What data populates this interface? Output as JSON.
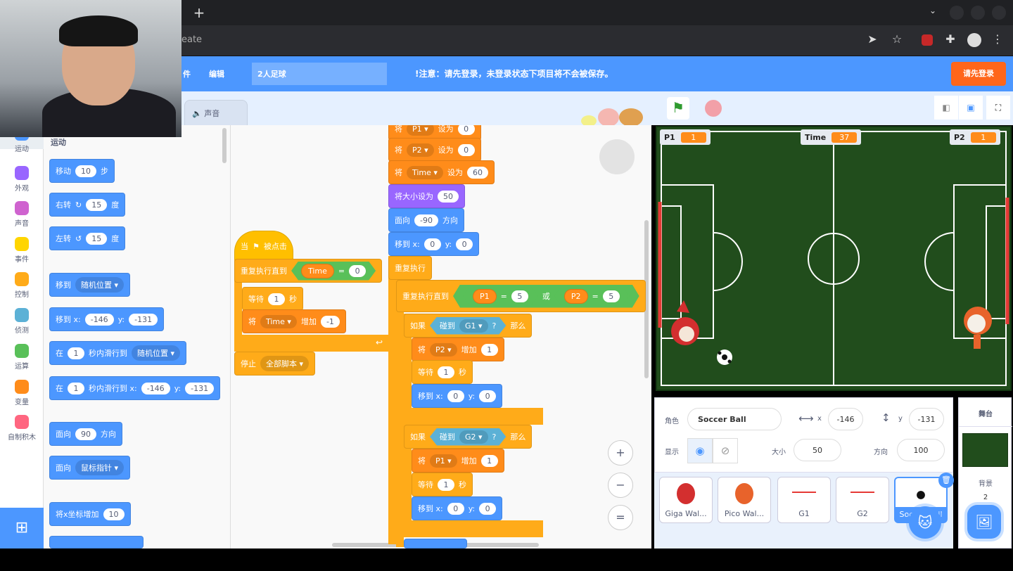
{
  "browser": {
    "new_tab": "+",
    "address_text": "eate",
    "colors": {
      "chrome": "#202124"
    }
  },
  "menu": {
    "file_partial": "件",
    "edit": "编辑",
    "project_title": "2人足球",
    "notice": "!注意：请先登录，未登录状态下项目将不会被保存。",
    "login_button": "请先登录"
  },
  "tabs": {
    "sound": "声音"
  },
  "categories": [
    {
      "label": "运动",
      "color": "#4c97ff"
    },
    {
      "label": "外观",
      "color": "#9966ff"
    },
    {
      "label": "声音",
      "color": "#cf63cf"
    },
    {
      "label": "事件",
      "color": "#ffd500"
    },
    {
      "label": "控制",
      "color": "#ffab19"
    },
    {
      "label": "侦测",
      "color": "#5cb1d6"
    },
    {
      "label": "运算",
      "color": "#59c059"
    },
    {
      "label": "变量",
      "color": "#ff8c1a"
    },
    {
      "label": "自制积木",
      "color": "#ff6680"
    }
  ],
  "palette": {
    "heading": "运动",
    "blocks": [
      {
        "cat": "motion",
        "parts": [
          {
            "text": "移动"
          },
          {
            "input": "10"
          },
          {
            "text": "步"
          }
        ]
      },
      {
        "cat": "motion",
        "parts": [
          {
            "text": "右转"
          },
          {
            "icon": "rotate-right-icon",
            "glyph": "↻"
          },
          {
            "input": "15"
          },
          {
            "text": "度"
          }
        ]
      },
      {
        "cat": "motion",
        "parts": [
          {
            "text": "左转"
          },
          {
            "icon": "rotate-left-icon",
            "glyph": "↺"
          },
          {
            "input": "15"
          },
          {
            "text": "度"
          }
        ]
      },
      {
        "cat": "motion",
        "parts": [
          {
            "text": "移到"
          },
          {
            "dropdown": "随机位置 ▾"
          }
        ]
      },
      {
        "cat": "motion",
        "parts": [
          {
            "text": "移到 x:"
          },
          {
            "input": "-146"
          },
          {
            "text": "y:"
          },
          {
            "input": "-131"
          }
        ]
      },
      {
        "cat": "motion",
        "parts": [
          {
            "text": "在"
          },
          {
            "input": "1"
          },
          {
            "text": "秒内滑行到"
          },
          {
            "dropdown": "随机位置 ▾"
          }
        ]
      },
      {
        "cat": "motion",
        "parts": [
          {
            "text": "在"
          },
          {
            "input": "1"
          },
          {
            "text": "秒内滑行到 x:"
          },
          {
            "input": "-146"
          },
          {
            "text": "y:"
          },
          {
            "input": "-131"
          }
        ]
      },
      {
        "cat": "motion",
        "parts": [
          {
            "text": "面向"
          },
          {
            "input": "90"
          },
          {
            "text": "方向"
          }
        ]
      },
      {
        "cat": "motion",
        "parts": [
          {
            "text": "面向"
          },
          {
            "dropdown": "鼠标指针 ▾"
          }
        ]
      },
      {
        "cat": "motion",
        "parts": [
          {
            "text": "将x坐标增加"
          },
          {
            "input": "10"
          }
        ]
      }
    ]
  },
  "scripts": [
    {
      "cat": "variables",
      "parts": [
        {
          "text": "将"
        },
        {
          "dropdown": "P1 ▾"
        },
        {
          "text": "设为"
        },
        {
          "input": "0"
        }
      ]
    },
    {
      "cat": "variables",
      "parts": [
        {
          "text": "将"
        },
        {
          "dropdown": "P2 ▾"
        },
        {
          "text": "设为"
        },
        {
          "input": "0"
        }
      ]
    },
    {
      "cat": "variables",
      "parts": [
        {
          "text": "将"
        },
        {
          "dropdown": "Time ▾"
        },
        {
          "text": "设为"
        },
        {
          "input": "60"
        }
      ]
    },
    {
      "cat": "looks",
      "parts": [
        {
          "text": "将大小设为"
        },
        {
          "input": "50"
        }
      ]
    },
    {
      "cat": "motion",
      "parts": [
        {
          "text": "面向"
        },
        {
          "input": "-90"
        },
        {
          "text": "方向"
        }
      ]
    },
    {
      "cat": "motion",
      "parts": [
        {
          "text": "移到 x:"
        },
        {
          "input": "0"
        },
        {
          "text": "y:"
        },
        {
          "input": "0"
        }
      ]
    },
    {
      "cat": "control",
      "parts": [
        {
          "text": "重复执行"
        }
      ]
    },
    {
      "cat": "control",
      "parts": [
        {
          "text": "重复执行直到"
        },
        {
          "bool": "operators",
          "parts": [
            {
              "bool": "operators",
              "parts": [
                {
                  "reporter": "P1",
                  "cat": "variables"
                },
                {
                  "text": "="
                },
                {
                  "input": "5"
                }
              ]
            },
            {
              "text": "或"
            },
            {
              "bool": "operators",
              "parts": [
                {
                  "reporter": "P2",
                  "cat": "variables"
                },
                {
                  "text": "="
                },
                {
                  "input": "5"
                }
              ]
            }
          ]
        }
      ]
    },
    {
      "cat": "control",
      "parts": [
        {
          "text": "如果"
        },
        {
          "bool": "sensing",
          "parts": [
            {
              "text": "碰到"
            },
            {
              "dropdown": "G1 ▾"
            },
            {
              "text": "?"
            }
          ]
        },
        {
          "text": "那么"
        }
      ]
    },
    {
      "cat": "variables",
      "parts": [
        {
          "text": "将"
        },
        {
          "dropdown": "P2 ▾"
        },
        {
          "text": "增加"
        },
        {
          "input": "1"
        }
      ]
    },
    {
      "cat": "control",
      "parts": [
        {
          "text": "等待"
        },
        {
          "input": "1"
        },
        {
          "text": "秒"
        }
      ]
    },
    {
      "cat": "motion",
      "parts": [
        {
          "text": "移到 x:"
        },
        {
          "input": "0"
        },
        {
          "text": "y:"
        },
        {
          "input": "0"
        }
      ]
    },
    {
      "cat": "control",
      "parts": [
        {
          "text": "如果"
        },
        {
          "bool": "sensing",
          "parts": [
            {
              "text": "碰到"
            },
            {
              "dropdown": "G2 ▾"
            },
            {
              "text": "?"
            }
          ]
        },
        {
          "text": "那么"
        }
      ]
    },
    {
      "cat": "variables",
      "parts": [
        {
          "text": "将"
        },
        {
          "dropdown": "P1 ▾"
        },
        {
          "text": "增加"
        },
        {
          "input": "1"
        }
      ]
    },
    {
      "cat": "control",
      "parts": [
        {
          "text": "等待"
        },
        {
          "input": "1"
        },
        {
          "text": "秒"
        }
      ]
    },
    {
      "cat": "motion",
      "parts": [
        {
          "text": "移到 x:"
        },
        {
          "input": "0"
        },
        {
          "text": "y:"
        },
        {
          "input": "0"
        }
      ]
    },
    {
      "cat": "events",
      "parts": [
        {
          "text": "当"
        },
        {
          "icon": "green-flag-icon",
          "glyph": "⚑"
        },
        {
          "text": "被点击"
        }
      ]
    },
    {
      "cat": "control",
      "parts": [
        {
          "text": "重复执行直到"
        },
        {
          "bool": "operators",
          "parts": [
            {
              "reporter": "Time",
              "cat": "variables"
            },
            {
              "text": "="
            },
            {
              "input": "0"
            }
          ]
        }
      ]
    },
    {
      "cat": "control",
      "parts": [
        {
          "text": "等待"
        },
        {
          "input": "1"
        },
        {
          "text": "秒"
        }
      ]
    },
    {
      "cat": "variables",
      "parts": [
        {
          "text": "将"
        },
        {
          "dropdown": "Time ▾"
        },
        {
          "text": "增加"
        },
        {
          "input": "-1"
        }
      ]
    },
    {
      "cat": "control",
      "parts": [
        {
          "text": "停止"
        },
        {
          "dropdown": "全部脚本 ▾"
        }
      ]
    }
  ],
  "zoom": {
    "in": "+",
    "out": "−",
    "reset": "="
  },
  "stage": {
    "monitors": [
      {
        "label": "P1",
        "value": "1"
      },
      {
        "label": "Time",
        "value": "37"
      },
      {
        "label": "P2",
        "value": "1"
      }
    ],
    "field_color": "#214d1c"
  },
  "sprite_info": {
    "sprite_label": "角色",
    "sprite_name": "Soccer Ball",
    "x_label": "x",
    "x": "-146",
    "y_label": "y",
    "y": "-131",
    "show_label": "显示",
    "size_label": "大小",
    "size": "50",
    "direction_label": "方向",
    "direction": "100"
  },
  "sprites": [
    {
      "name": "Giga Wal..."
    },
    {
      "name": "Pico Wal..."
    },
    {
      "name": "G1"
    },
    {
      "name": "G2"
    },
    {
      "name": "Soccer Ball",
      "selected": true
    }
  ],
  "stage_panel": {
    "label": "舞台",
    "backdrop_label": "背景",
    "backdrop_count": "2"
  }
}
